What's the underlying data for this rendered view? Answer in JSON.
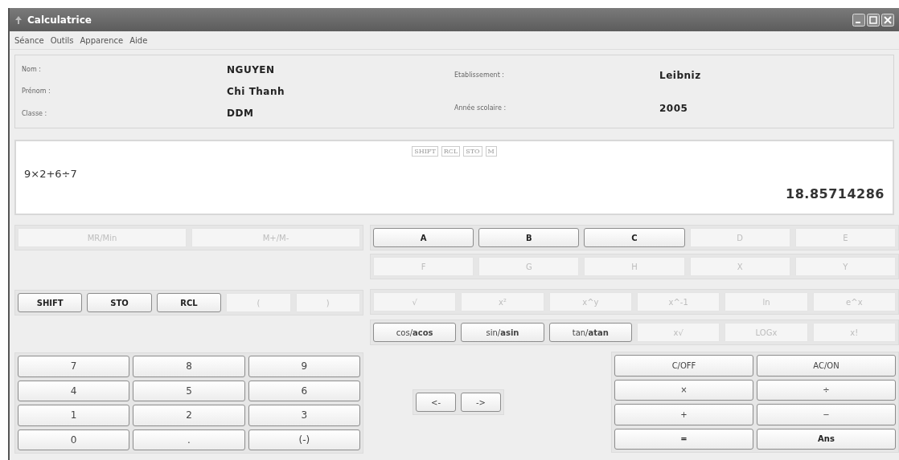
{
  "window": {
    "title": "Calculatrice"
  },
  "menu": [
    "Séance",
    "Outils",
    "Apparence",
    "Aide"
  ],
  "student_left": [
    {
      "label": "Nom :",
      "value": "NGUYEN"
    },
    {
      "label": "Prénom :",
      "value": "Chi Thanh"
    },
    {
      "label": "Classe :",
      "value": "DDM"
    }
  ],
  "student_right": [
    {
      "label": "Etablissement :",
      "value": "Leibniz"
    },
    {
      "label": "Année scolaire :",
      "value": "2005"
    }
  ],
  "display": {
    "indicators": [
      "SHIFT",
      "RCL",
      "STO",
      "M"
    ],
    "expression": "9×2+6÷7",
    "result": "18.85714286"
  },
  "memory_keys": [
    {
      "label": "MR/Min",
      "disabled": true
    },
    {
      "label": "M+/M-",
      "disabled": true
    }
  ],
  "mode_keys": [
    {
      "label": "SHIFT",
      "disabled": false,
      "bold": true
    },
    {
      "label": "STO",
      "disabled": false,
      "bold": true
    },
    {
      "label": "RCL",
      "disabled": false,
      "bold": true
    },
    {
      "label": "(",
      "disabled": true
    },
    {
      "label": ")",
      "disabled": true
    }
  ],
  "letter_keys": [
    [
      {
        "label": "A",
        "disabled": false,
        "bold": true
      },
      {
        "label": "B",
        "disabled": false,
        "bold": true
      },
      {
        "label": "C",
        "disabled": false,
        "bold": true
      },
      {
        "label": "D",
        "disabled": true
      },
      {
        "label": "E",
        "disabled": true
      }
    ],
    [
      {
        "label": "F",
        "disabled": true
      },
      {
        "label": "G",
        "disabled": true
      },
      {
        "label": "H",
        "disabled": true
      },
      {
        "label": "X",
        "disabled": true
      },
      {
        "label": "Y",
        "disabled": true
      }
    ]
  ],
  "function_keys": [
    [
      {
        "label": "√",
        "disabled": true
      },
      {
        "label": "x²",
        "disabled": true
      },
      {
        "label": "x^y",
        "disabled": true
      },
      {
        "label": "x^-1",
        "disabled": true
      },
      {
        "label": "ln",
        "disabled": true
      },
      {
        "label": "e^x",
        "disabled": true
      }
    ],
    [
      {
        "label": "cos/**acos**",
        "disabled": false
      },
      {
        "label": "sin/**asin**",
        "disabled": false
      },
      {
        "label": "tan/**atan**",
        "disabled": false
      },
      {
        "label": "x√",
        "disabled": true
      },
      {
        "label": "LOGx",
        "disabled": true
      },
      {
        "label": "x!",
        "disabled": true
      }
    ]
  ],
  "number_keys": [
    {
      "label": "7",
      "disabled": false
    },
    {
      "label": "8",
      "disabled": false
    },
    {
      "label": "9",
      "disabled": false
    },
    {
      "label": "4",
      "disabled": false
    },
    {
      "label": "5",
      "disabled": false
    },
    {
      "label": "6",
      "disabled": false
    },
    {
      "label": "1",
      "disabled": false
    },
    {
      "label": "2",
      "disabled": false
    },
    {
      "label": "3",
      "disabled": false
    },
    {
      "label": "0",
      "disabled": false
    },
    {
      "label": ".",
      "disabled": false
    },
    {
      "label": "(-)",
      "disabled": false
    }
  ],
  "cursor_keys": [
    {
      "label": "<-",
      "disabled": false
    },
    {
      "label": "->",
      "disabled": false
    }
  ],
  "operation_keys": [
    {
      "label": "C/OFF",
      "disabled": false
    },
    {
      "label": "AC/ON",
      "disabled": false
    },
    {
      "label": "×",
      "disabled": false
    },
    {
      "label": "÷",
      "disabled": false
    },
    {
      "label": "+",
      "disabled": false
    },
    {
      "label": "−",
      "disabled": false
    },
    {
      "label": "=",
      "disabled": false,
      "bold": true
    },
    {
      "label": "Ans",
      "disabled": false,
      "bold": true
    }
  ]
}
